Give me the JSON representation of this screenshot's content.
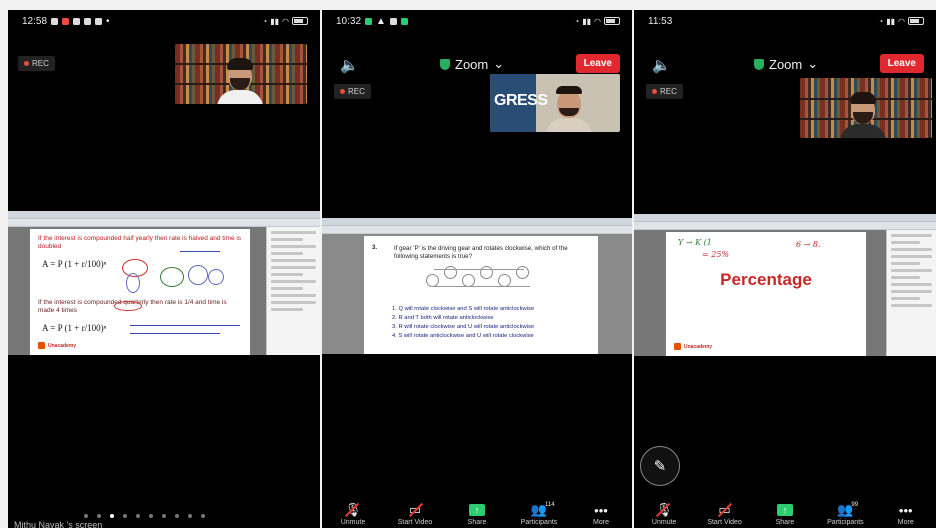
{
  "panels": [
    {
      "status": {
        "time": "12:58"
      },
      "rec_label": "REC",
      "slide": {
        "heading": "If the interest is compounded half yearly then rate is halved and time is doubled",
        "note": "If the interest is compounded quarterly then rate is 1/4 and time is made 4 times",
        "formula_a": "A = P (1 + r/100)ⁿ",
        "formula_b": "A = P (1 + r/100)ⁿ",
        "brand": "Unacademy"
      },
      "ticker": "Mithu Nayak 's screen"
    },
    {
      "status": {
        "time": "10:32"
      },
      "meeting_title": "Zoom",
      "leave_label": "Leave",
      "rec_label": "REC",
      "video_text": "GRESS",
      "slide": {
        "number": "3.",
        "question": "If gear 'P' is the driving gear and rotates clockwise, which of the following statements is true?",
        "options": [
          "1. Q will rotate clockwise and S will rotate anticlockwise",
          "2. R and T both will rotate anticlockwise",
          "3. R will rotate clockwise and U will rotate anticlockwise",
          "4. S will rotate anticlockwise and U will rotate clockwise"
        ]
      },
      "toolbar": [
        {
          "label": "Unmute",
          "icon": "microphone-muted-icon"
        },
        {
          "label": "Start Video",
          "icon": "camera-off-icon"
        },
        {
          "label": "Share",
          "icon": "share-screen-icon"
        },
        {
          "label": "Participants",
          "count": "114",
          "icon": "participants-icon"
        },
        {
          "label": "More",
          "icon": "more-icon"
        }
      ]
    },
    {
      "status": {
        "time": "11:53"
      },
      "meeting_title": "Zoom",
      "leave_label": "Leave",
      "rec_label": "REC",
      "slide": {
        "title": "Percentage",
        "brand": "Unacademy",
        "hand_a": "Y → K (1",
        "hand_b": "6 → 8.",
        "hand_c": "= 25%"
      },
      "toolbar": [
        {
          "label": "Unmute",
          "icon": "microphone-muted-icon"
        },
        {
          "label": "Start Video",
          "icon": "camera-off-icon"
        },
        {
          "label": "Share",
          "icon": "share-screen-icon"
        },
        {
          "label": "Participants",
          "count": "99",
          "icon": "participants-icon"
        },
        {
          "label": "More",
          "icon": "more-icon"
        }
      ]
    }
  ],
  "colors": {
    "leave": "#e0282e",
    "share": "#2ecc71",
    "slide_red": "#c62828"
  }
}
